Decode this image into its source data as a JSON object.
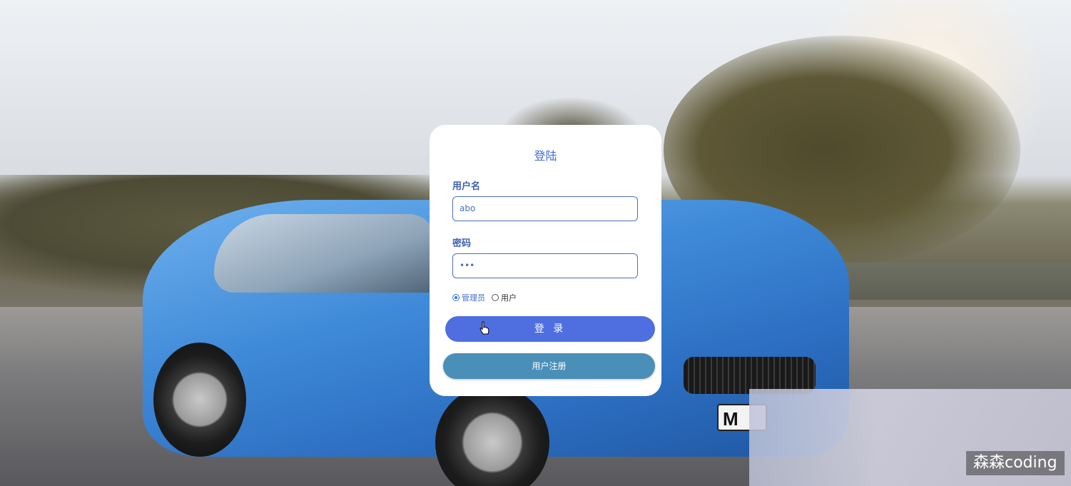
{
  "login": {
    "title": "登陆",
    "username_label": "用户名",
    "username_value": "abo",
    "password_label": "密码",
    "password_value": "•••",
    "roles": [
      {
        "label": "管理员",
        "checked": true
      },
      {
        "label": "用户",
        "checked": false
      }
    ],
    "login_button": "登 录",
    "register_button": "用户注册"
  },
  "background": {
    "plate_text": "M"
  },
  "watermark": "森森coding",
  "colors": {
    "accent": "#4f6fe0",
    "register": "#4a8fb8",
    "label": "#3f5fb0"
  }
}
